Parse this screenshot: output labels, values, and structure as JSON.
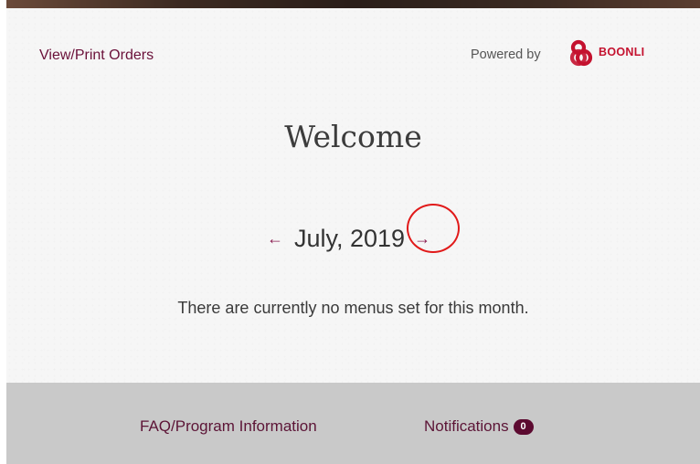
{
  "header": {
    "view_orders_label": "View/Print Orders",
    "powered_by_label": "Powered by",
    "brand_name": "BOONLI"
  },
  "main": {
    "title": "Welcome",
    "prev_icon": "arrow-left-icon",
    "next_icon": "arrow-right-icon",
    "prev_symbol": "←",
    "next_symbol": "→",
    "month_label": "July, 2019",
    "empty_message": "There are currently no menus set for this month."
  },
  "footer": {
    "faq_label": "FAQ/Program Information",
    "notifications_label": "Notifications",
    "notifications_count": "0"
  },
  "colors": {
    "accent": "#6a1039",
    "brand": "#c4122f",
    "badge": "#5c0a30",
    "annotation": "#e11a1a",
    "footer_bg": "#c9c9c9",
    "card_bg": "#f6f6f6"
  }
}
